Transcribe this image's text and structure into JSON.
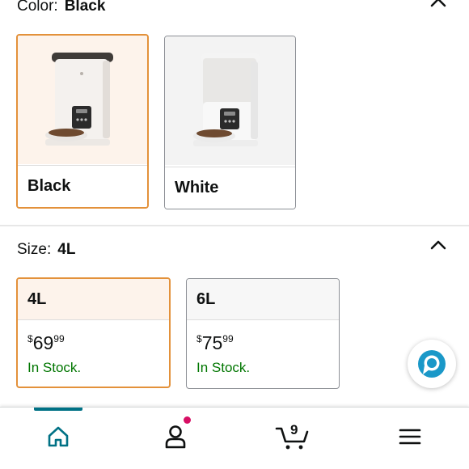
{
  "color_section": {
    "label": "Color:",
    "selected_value": "Black",
    "options": [
      {
        "name": "Black",
        "selected": true
      },
      {
        "name": "White",
        "selected": false
      }
    ]
  },
  "size_section": {
    "label": "Size:",
    "selected_value": "4L",
    "options": [
      {
        "name": "4L",
        "price_symbol": "$",
        "price_whole": "69",
        "price_fraction": "99",
        "stock": "In Stock.",
        "selected": true
      },
      {
        "name": "6L",
        "price_symbol": "$",
        "price_whole": "75",
        "price_fraction": "99",
        "stock": "In Stock.",
        "selected": false
      }
    ]
  },
  "nav": {
    "cart_count": "9",
    "items": [
      "home-icon",
      "account-icon",
      "cart-icon",
      "menu-icon"
    ]
  },
  "colors": {
    "selected_border": "#e3913a",
    "in_stock": "#007600",
    "accent": "#007185",
    "badge": "#d70f64",
    "alexa": "#1a98c8"
  }
}
